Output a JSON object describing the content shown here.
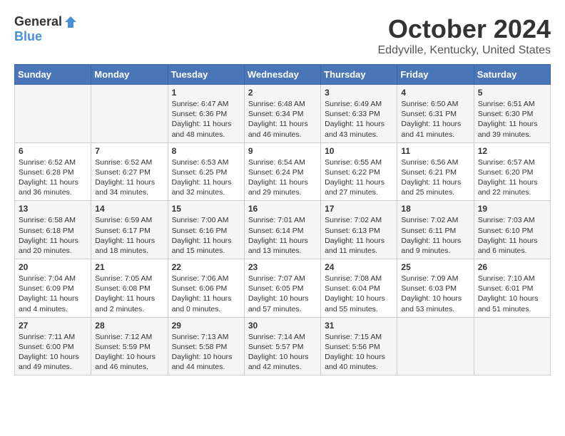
{
  "logo": {
    "general": "General",
    "blue": "Blue"
  },
  "title": "October 2024",
  "location": "Eddyville, Kentucky, United States",
  "weekdays": [
    "Sunday",
    "Monday",
    "Tuesday",
    "Wednesday",
    "Thursday",
    "Friday",
    "Saturday"
  ],
  "weeks": [
    [
      {
        "day": "",
        "content": ""
      },
      {
        "day": "",
        "content": ""
      },
      {
        "day": "1",
        "content": "Sunrise: 6:47 AM\nSunset: 6:36 PM\nDaylight: 11 hours and 48 minutes."
      },
      {
        "day": "2",
        "content": "Sunrise: 6:48 AM\nSunset: 6:34 PM\nDaylight: 11 hours and 46 minutes."
      },
      {
        "day": "3",
        "content": "Sunrise: 6:49 AM\nSunset: 6:33 PM\nDaylight: 11 hours and 43 minutes."
      },
      {
        "day": "4",
        "content": "Sunrise: 6:50 AM\nSunset: 6:31 PM\nDaylight: 11 hours and 41 minutes."
      },
      {
        "day": "5",
        "content": "Sunrise: 6:51 AM\nSunset: 6:30 PM\nDaylight: 11 hours and 39 minutes."
      }
    ],
    [
      {
        "day": "6",
        "content": "Sunrise: 6:52 AM\nSunset: 6:28 PM\nDaylight: 11 hours and 36 minutes."
      },
      {
        "day": "7",
        "content": "Sunrise: 6:52 AM\nSunset: 6:27 PM\nDaylight: 11 hours and 34 minutes."
      },
      {
        "day": "8",
        "content": "Sunrise: 6:53 AM\nSunset: 6:25 PM\nDaylight: 11 hours and 32 minutes."
      },
      {
        "day": "9",
        "content": "Sunrise: 6:54 AM\nSunset: 6:24 PM\nDaylight: 11 hours and 29 minutes."
      },
      {
        "day": "10",
        "content": "Sunrise: 6:55 AM\nSunset: 6:22 PM\nDaylight: 11 hours and 27 minutes."
      },
      {
        "day": "11",
        "content": "Sunrise: 6:56 AM\nSunset: 6:21 PM\nDaylight: 11 hours and 25 minutes."
      },
      {
        "day": "12",
        "content": "Sunrise: 6:57 AM\nSunset: 6:20 PM\nDaylight: 11 hours and 22 minutes."
      }
    ],
    [
      {
        "day": "13",
        "content": "Sunrise: 6:58 AM\nSunset: 6:18 PM\nDaylight: 11 hours and 20 minutes."
      },
      {
        "day": "14",
        "content": "Sunrise: 6:59 AM\nSunset: 6:17 PM\nDaylight: 11 hours and 18 minutes."
      },
      {
        "day": "15",
        "content": "Sunrise: 7:00 AM\nSunset: 6:16 PM\nDaylight: 11 hours and 15 minutes."
      },
      {
        "day": "16",
        "content": "Sunrise: 7:01 AM\nSunset: 6:14 PM\nDaylight: 11 hours and 13 minutes."
      },
      {
        "day": "17",
        "content": "Sunrise: 7:02 AM\nSunset: 6:13 PM\nDaylight: 11 hours and 11 minutes."
      },
      {
        "day": "18",
        "content": "Sunrise: 7:02 AM\nSunset: 6:11 PM\nDaylight: 11 hours and 9 minutes."
      },
      {
        "day": "19",
        "content": "Sunrise: 7:03 AM\nSunset: 6:10 PM\nDaylight: 11 hours and 6 minutes."
      }
    ],
    [
      {
        "day": "20",
        "content": "Sunrise: 7:04 AM\nSunset: 6:09 PM\nDaylight: 11 hours and 4 minutes."
      },
      {
        "day": "21",
        "content": "Sunrise: 7:05 AM\nSunset: 6:08 PM\nDaylight: 11 hours and 2 minutes."
      },
      {
        "day": "22",
        "content": "Sunrise: 7:06 AM\nSunset: 6:06 PM\nDaylight: 11 hours and 0 minutes."
      },
      {
        "day": "23",
        "content": "Sunrise: 7:07 AM\nSunset: 6:05 PM\nDaylight: 10 hours and 57 minutes."
      },
      {
        "day": "24",
        "content": "Sunrise: 7:08 AM\nSunset: 6:04 PM\nDaylight: 10 hours and 55 minutes."
      },
      {
        "day": "25",
        "content": "Sunrise: 7:09 AM\nSunset: 6:03 PM\nDaylight: 10 hours and 53 minutes."
      },
      {
        "day": "26",
        "content": "Sunrise: 7:10 AM\nSunset: 6:01 PM\nDaylight: 10 hours and 51 minutes."
      }
    ],
    [
      {
        "day": "27",
        "content": "Sunrise: 7:11 AM\nSunset: 6:00 PM\nDaylight: 10 hours and 49 minutes."
      },
      {
        "day": "28",
        "content": "Sunrise: 7:12 AM\nSunset: 5:59 PM\nDaylight: 10 hours and 46 minutes."
      },
      {
        "day": "29",
        "content": "Sunrise: 7:13 AM\nSunset: 5:58 PM\nDaylight: 10 hours and 44 minutes."
      },
      {
        "day": "30",
        "content": "Sunrise: 7:14 AM\nSunset: 5:57 PM\nDaylight: 10 hours and 42 minutes."
      },
      {
        "day": "31",
        "content": "Sunrise: 7:15 AM\nSunset: 5:56 PM\nDaylight: 10 hours and 40 minutes."
      },
      {
        "day": "",
        "content": ""
      },
      {
        "day": "",
        "content": ""
      }
    ]
  ]
}
